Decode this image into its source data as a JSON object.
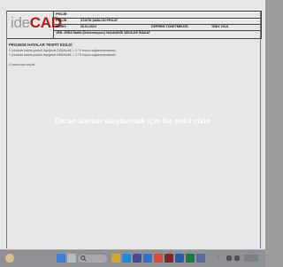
{
  "document": {
    "logo": {
      "ide": "ide",
      "cad": "CAD",
      "sub": "ideCAD"
    },
    "header_rows": [
      {
        "key": "PROJE:",
        "value": ""
      },
      {
        "key": "PROJE:",
        "value": "STATİK ŞABLON PROJE"
      },
      {
        "key": "TARİH:",
        "value": "06.01.2024",
        "key2": "DEPREM YÖNETMELİĞİ:",
        "value2": "TBDY 2018"
      },
      {
        "key": "",
        "value": "1RB- 2RB3 Statik (Deformasyon) YAŞANDIĞI ŞEKİLDE İNŞAAT"
      }
    ],
    "section_title": "PROJEDE HATALAR TESPİT EDİLDİ",
    "lines": [
      "X yönünde katına yanlızlı ölçeğinde DMAKs/ML = 0.75 koşulu sağlanmamaktadır.",
      "Y yönünde katına yanlızlı ölçeğinde DMAKs/ML = 0.75 koşulu sağlanmamaktadır.",
      "X kata boyut seçildi."
    ]
  },
  "overlay": {
    "message": "Ekran alıntısı oluşturmak için bir şekil çizin"
  },
  "taskbar": {
    "search_icon": "search-icon",
    "apps": [
      "start-icon",
      "search-icon",
      "taskview-icon",
      "explorer-icon",
      "edge-icon",
      "store-icon",
      "mail-icon",
      "chrome-icon",
      "idecad-icon",
      "word-icon",
      "excel-icon",
      "snip-icon"
    ],
    "tray_text": "^"
  },
  "colors": {
    "brand_cad": "#b21d1d",
    "overlay_dim": "#9c9c9c"
  }
}
